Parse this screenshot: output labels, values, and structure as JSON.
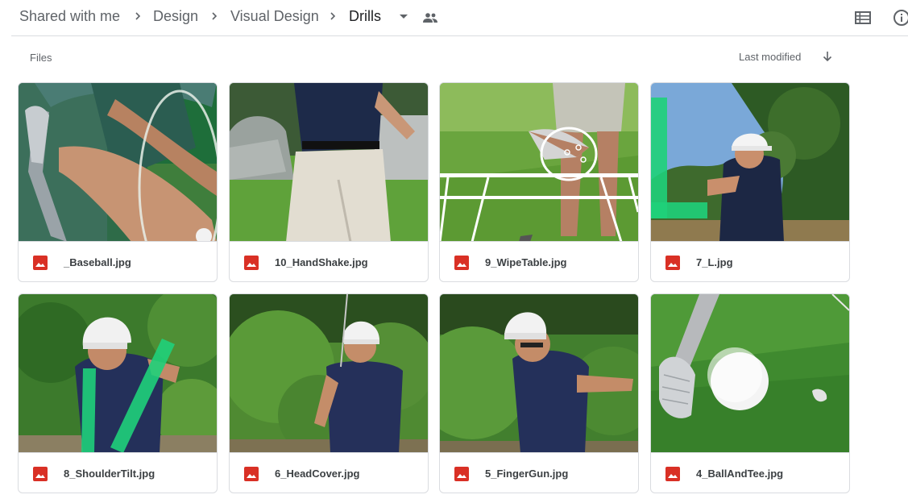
{
  "breadcrumb": {
    "items": [
      "Shared with me",
      "Design",
      "Visual Design",
      "Drills"
    ]
  },
  "icons": {
    "separator": "chevron-right-icon",
    "dropdown": "arrow-drop-down-icon",
    "shared": "people-icon",
    "view": "list-view-icon",
    "info": "info-icon",
    "file": "image-file-icon",
    "sort": "arrow-down-icon"
  },
  "toolbar": {
    "section_label": "Files",
    "sort_label": "Last modified"
  },
  "files": [
    {
      "name": "_Baseball.jpg"
    },
    {
      "name": "10_HandShake.jpg"
    },
    {
      "name": "9_WipeTable.jpg"
    },
    {
      "name": "7_L.jpg"
    },
    {
      "name": "8_ShoulderTilt.jpg"
    },
    {
      "name": "6_HeadCover.jpg"
    },
    {
      "name": "5_FingerGun.jpg"
    },
    {
      "name": "4_BallAndTee.jpg"
    }
  ],
  "colors": {
    "file_icon_red": "#d93025",
    "grass_green": "#4f8f2f",
    "shirt_navy": "#232f52",
    "highlight_green": "#1fd07a",
    "border": "#dadce0"
  }
}
